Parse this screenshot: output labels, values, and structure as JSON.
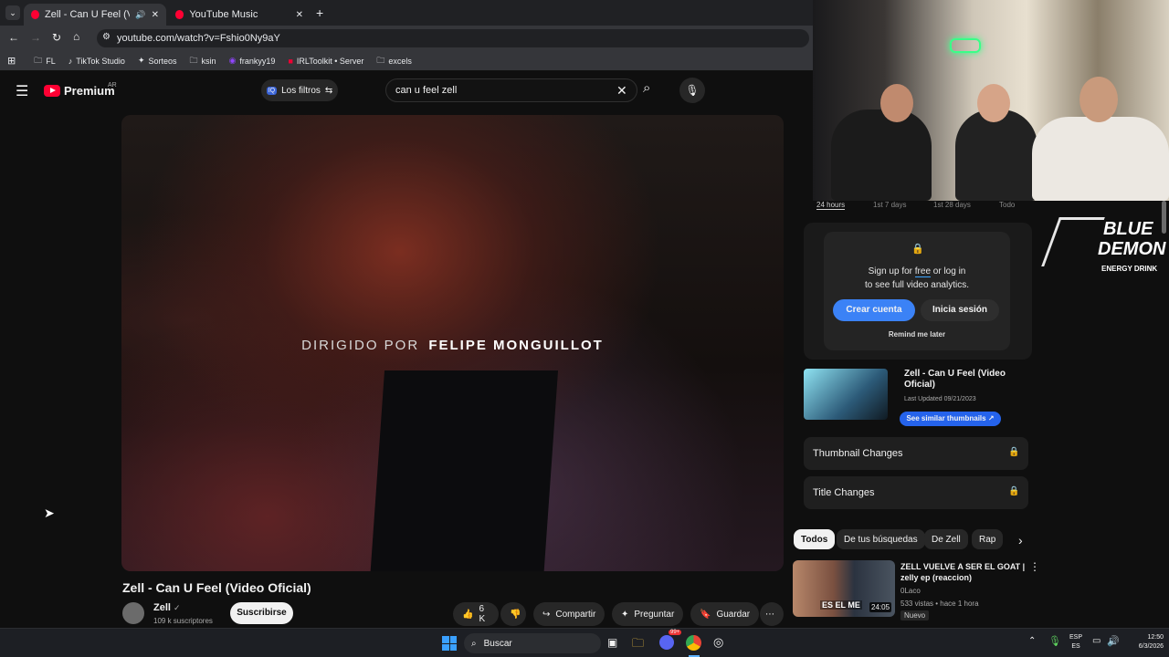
{
  "browser": {
    "tabs": [
      {
        "title": "Zell - Can U Feel (Video Ofic"
      },
      {
        "title": "YouTube Music"
      }
    ],
    "url": "youtube.com/watch?v=Fshio0Ny9aY",
    "bookmarks": [
      "FL",
      "TikTok Studio",
      "Sorteos",
      "ksin",
      "frankyy19",
      "IRLToolkit • Server",
      "excels"
    ]
  },
  "youtube": {
    "logo": "Premium",
    "region": "AR",
    "filters_label": "Los filtros",
    "search_value": "can u feel zell",
    "video": {
      "caption_prefix": "DIRIGIDO POR",
      "caption_name": "FELIPE MONGUILLOT",
      "title": "Zell - Can U Feel (Video Oficial)",
      "channel": "Zell",
      "subscribers": "109 k suscriptores",
      "subscribe": "Suscribirse",
      "likes": "6 K",
      "share": "Compartir",
      "ask": "Preguntar",
      "save": "Guardar"
    },
    "analytics": {
      "ranges": [
        "24 hours",
        "1st 7 days",
        "1st 28 days",
        "Todo"
      ],
      "prompt_line1_a": "Sign up for ",
      "prompt_free": "free",
      "prompt_line1_b": " or log in",
      "prompt_line2": "to see full video analytics.",
      "create_account": "Crear cuenta",
      "login": "Inicia sesión",
      "remind": "Remind me later",
      "thumb_title": "Zell - Can U Feel (Video Oficial)",
      "last_updated": "Last Updated 09/21/2023",
      "similar_btn": "See similar thumbnails ↗",
      "thumbnail_changes": "Thumbnail Changes",
      "title_changes": "Title Changes"
    },
    "chips": [
      "Todos",
      "De tus búsquedas",
      "De Zell",
      "Rap"
    ],
    "recommended": {
      "title": "ZELL VUELVE A SER EL GOAT | zelly ep (reaccion)",
      "channel": "0Laco",
      "meta": "533 vistas • hace 1 hora",
      "badge": "Nuevo",
      "duration": "24:05",
      "thumb_text": "ES EL ME"
    }
  },
  "sponsor": {
    "line1": "BLUE",
    "line2": "DEMON",
    "line3": "ENERGY DRINK"
  },
  "taskbar": {
    "search": "Buscar",
    "lang1": "ESP",
    "lang2": "ES",
    "time": "12:50",
    "date": "6/3/2026",
    "badge": "99+"
  },
  "colors": {
    "accent": "#3ea6ff",
    "yt_red": "#ff0033",
    "blue_btn": "#3b82f6"
  }
}
